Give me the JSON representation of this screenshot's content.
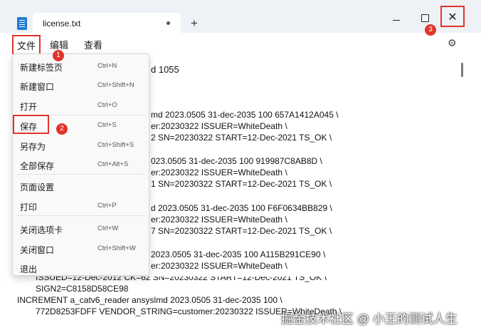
{
  "tab": {
    "title": "license.txt",
    "close_glyph": "●",
    "new_tab_glyph": "+"
  },
  "window": {
    "close_glyph": "✕"
  },
  "menubar": {
    "file": "文件",
    "edit": "编辑",
    "view": "查看",
    "settings_glyph": "⚙"
  },
  "file_menu": [
    {
      "label": "新建标签页",
      "shortcut": "Ctrl+N"
    },
    {
      "label": "新建窗口",
      "shortcut": "Ctrl+Shift+N"
    },
    {
      "label": "打开",
      "shortcut": "Ctrl+O"
    },
    {
      "label": "保存",
      "shortcut": "Ctrl+S"
    },
    {
      "label": "另存为",
      "shortcut": "Ctrl+Shift+S"
    },
    {
      "label": "全部保存",
      "shortcut": "Ctrl+Alt+S"
    },
    {
      "label": "页面设置",
      "shortcut": ""
    },
    {
      "label": "打印",
      "shortcut": "Ctrl+P"
    },
    {
      "label": "关闭选项卡",
      "shortcut": "Ctrl+W"
    },
    {
      "label": "关闭窗口",
      "shortcut": "Ctrl+Shift+W"
    },
    {
      "label": "退出",
      "shortcut": ""
    }
  ],
  "badges": [
    "1",
    "2",
    "3"
  ],
  "editor_lines": [
    "d 1055",
    "md 2023.0505 31-dec-2035 100 657A1412A045 \\",
    "er:20230322 ISSUER=WhiteDeath \\",
    "2 SN=20230322 START=12-Dec-2021 TS_OK \\",
    "023.0505 31-dec-2035 100 919987C8AB8D \\",
    "er:20230322 ISSUER=WhiteDeath \\",
    "1 SN=20230322 START=12-Dec-2021 TS_OK \\",
    "d 2023.0505 31-dec-2035 100 F6F0634BB829 \\",
    "er:20230322 ISSUER=WhiteDeath \\",
    "7 SN=20230322 START=12-Dec-2021 TS_OK \\",
    "2023.0505 31-dec-2035 100 A115B291CE90 \\",
    "er:20230322 ISSUER=WhiteDeath \\",
    "ISSUED=12-Dec-2012 CK=62 SN=20230322 START=12-Dec-2021 TS_OK \\",
    "SIGN2=C8158D58CE98",
    "INCREMENT a_catv6_reader ansyslmd 2023.0505 31-dec-2035 100 \\",
    "772D8253FDFF VENDOR_STRING=customer:20230322 ISSUER=WhiteDeath \\"
  ],
  "watermark": "掘金技术社区 @ 小王的测试人生",
  "colors": {
    "highlight": "#e0352b",
    "menu_bg": "#f9f9f9",
    "titlebar_bg": "#eef1f6"
  }
}
